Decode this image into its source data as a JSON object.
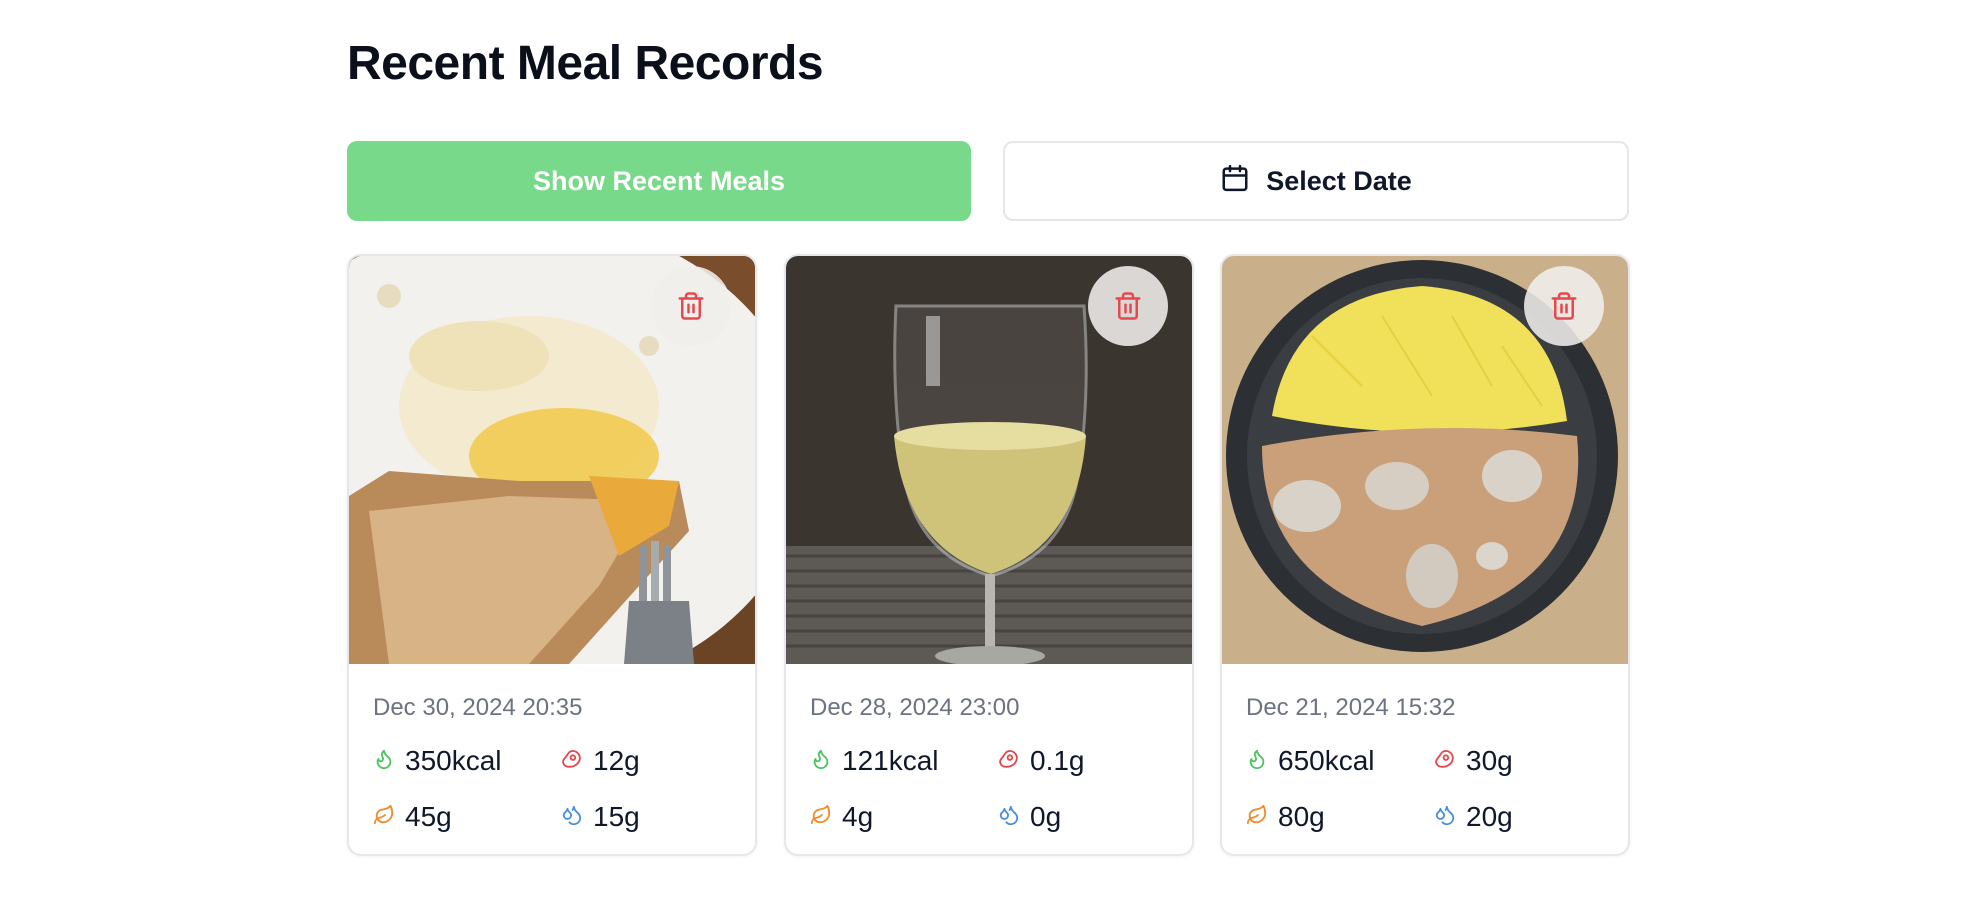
{
  "page": {
    "title": "Recent Meal Records"
  },
  "controls": {
    "show_recent_label": "Show Recent Meals",
    "select_date_label": "Select Date",
    "calendar_icon": "calendar-icon"
  },
  "colors": {
    "accent_green": "#79d98a",
    "delete_red": "#e5484d",
    "calories": "#4cc460",
    "protein": "#e5484d",
    "carbs": "#f08c2c",
    "fat": "#4a90d9"
  },
  "meals": [
    {
      "timestamp": "Dec 30, 2024 20:35",
      "calories": "350kcal",
      "protein": "12g",
      "carbs": "45g",
      "fat": "15g"
    },
    {
      "timestamp": "Dec 28, 2024 23:00",
      "calories": "121kcal",
      "protein": "0.1g",
      "carbs": "4g",
      "fat": "0g"
    },
    {
      "timestamp": "Dec 21, 2024 15:32",
      "calories": "650kcal",
      "protein": "30g",
      "carbs": "80g",
      "fat": "20g"
    }
  ],
  "icons": {
    "calories": "flame-icon",
    "protein": "meat-icon",
    "carbs": "leaf-icon",
    "fat": "droplets-icon",
    "delete": "trash-icon"
  }
}
